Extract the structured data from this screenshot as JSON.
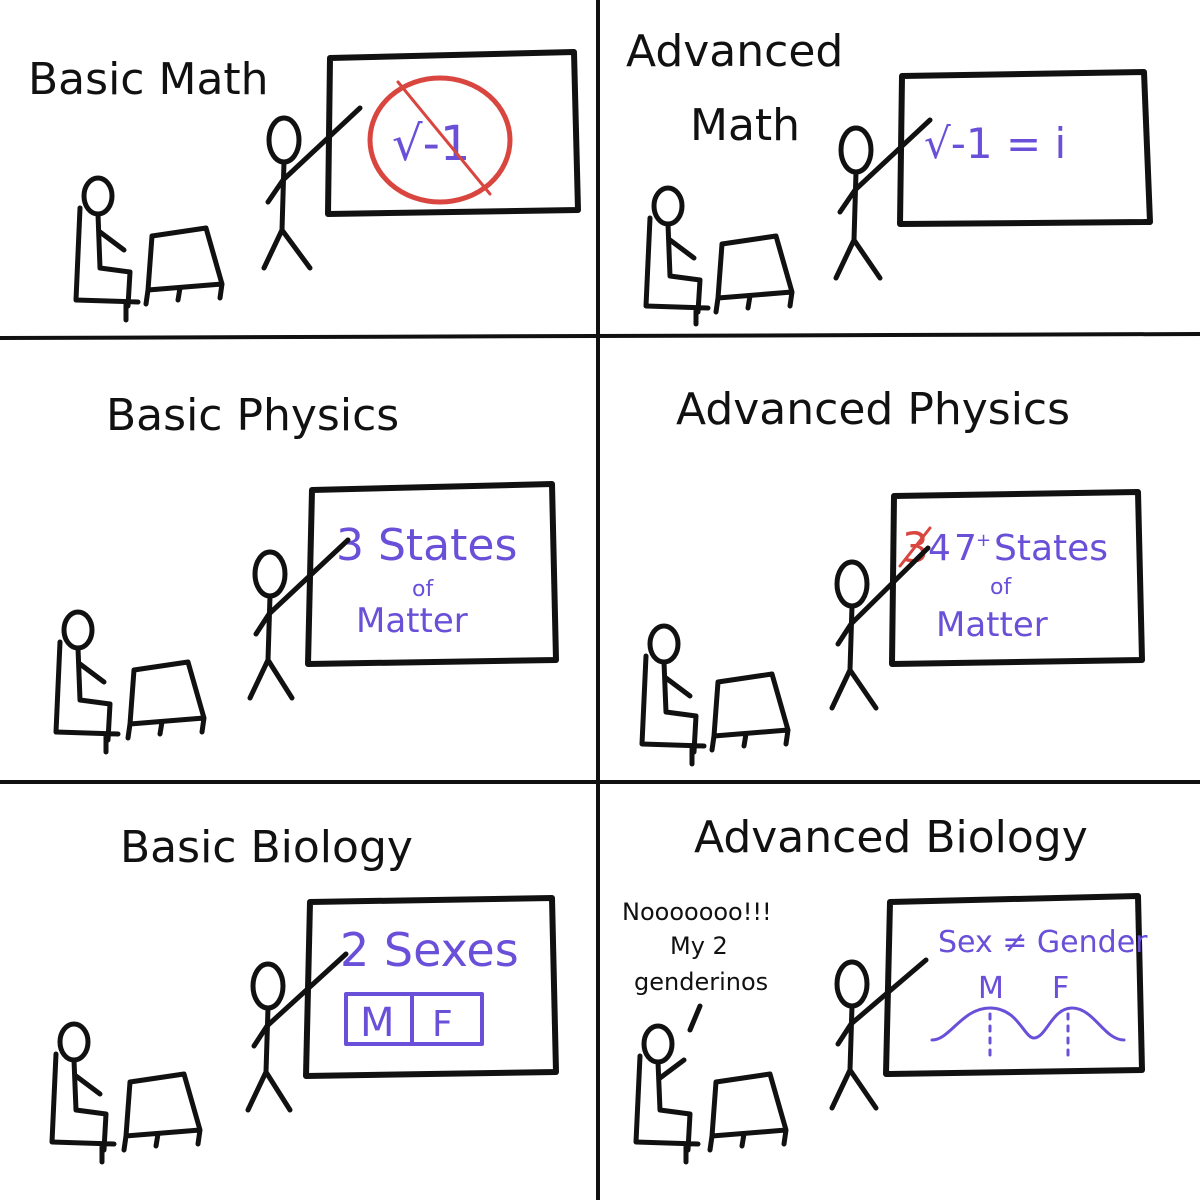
{
  "panels": [
    {
      "title_lines": [
        "Basic Math"
      ],
      "board_text": [
        "√-1"
      ]
    },
    {
      "title_lines": [
        "Advanced",
        "Math"
      ],
      "board_text": [
        "√-1 = i"
      ]
    },
    {
      "title_lines": [
        "Basic Physics"
      ],
      "board_text": [
        "3 States",
        "of",
        "Matter"
      ]
    },
    {
      "title_lines": [
        "Advanced Physics"
      ],
      "board_text": [
        "3",
        "4",
        "7",
        "+",
        "States",
        "of",
        "Matter"
      ]
    },
    {
      "title_lines": [
        "Basic Biology"
      ],
      "board_text": [
        "2 Sexes",
        "M",
        "F"
      ]
    },
    {
      "title_lines": [
        "Advanced Biology"
      ],
      "board_text": [
        "Sex ≠ Gender",
        "M",
        "F"
      ]
    }
  ],
  "speech_bubble": [
    "Nooooooo!!!",
    "My 2",
    "genderinos"
  ],
  "colors": {
    "ink": "#111111",
    "marker_purple": "#6a4fd8",
    "marker_red": "#d9463f"
  }
}
